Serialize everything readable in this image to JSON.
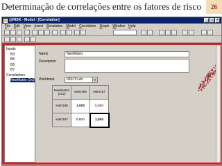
{
  "slide": {
    "title": "Determinação de correlações entre os fatores de risco",
    "number": "26"
  },
  "window": {
    "title": "@RISK - Model - [Correlation]"
  },
  "menu": [
    "File",
    "Edit",
    "View",
    "Insert",
    "Simulation",
    "Model",
    "Correlation",
    "Graph",
    "Window",
    "Help"
  ],
  "tree": {
    "items": [
      {
        "label": "Inputs",
        "level": 0,
        "selected": false
      },
      {
        "label": "B3",
        "level": 1,
        "selected": false
      },
      {
        "label": "B5",
        "level": 1,
        "selected": false
      },
      {
        "label": "B6",
        "level": 1,
        "selected": false
      },
      {
        "label": "B7",
        "level": 1,
        "selected": false
      },
      {
        "label": "Correlations",
        "level": 0,
        "selected": false
      },
      {
        "label": "NewMatrix (2x2)",
        "level": 1,
        "selected": true
      }
    ]
  },
  "form": {
    "name_label": "Name",
    "name_value": "NewMatrix",
    "description_label": "Description",
    "description_value": "",
    "workbook_label": "Workbook",
    "workbook_value": "RISCO.xls"
  },
  "matrix": {
    "corner": "NewMatrix (2x2)",
    "headers": [
      "ssk0185",
      "ssk0187"
    ],
    "rows": [
      {
        "label": "ssk0185",
        "values": [
          "1,000",
          "0,800"
        ]
      },
      {
        "label": "ssk0187",
        "values": [
          "0,800",
          "1,000"
        ]
      }
    ]
  },
  "colors": {
    "titlebar": "#0a246a",
    "highlight_frame": "#d21f1f",
    "scatter_points": "#9b1c1c",
    "slide_number_bg": "#f2ddb6",
    "slide_number_text": "#b4211d"
  }
}
